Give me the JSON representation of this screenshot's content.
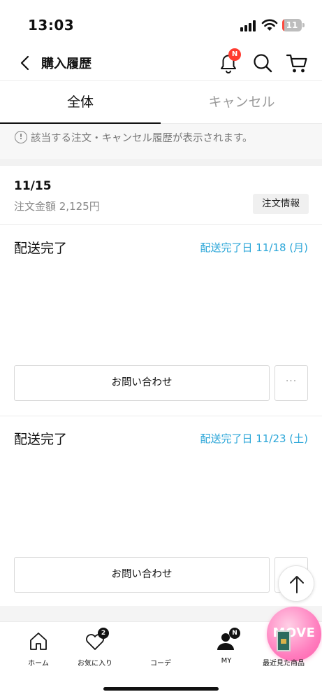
{
  "status_bar": {
    "time": "13:03",
    "battery": "11",
    "battery_level": 0.11
  },
  "header": {
    "title": "購入履歴",
    "bell_badge": "N"
  },
  "tabs": [
    {
      "label": "全体",
      "active": true
    },
    {
      "label": "キャンセル",
      "active": false
    }
  ],
  "notice": {
    "icon": "!",
    "text": "該当する注文・キャンセル履歴が表示されます。"
  },
  "order": {
    "date": "11/15",
    "amount": "注文金額 2,125円",
    "info_button": "注文情報",
    "deliveries": [
      {
        "status": "配送完了",
        "date": "配送完了日 11/18 (月)",
        "inquiry": "お問い合わせ",
        "more": "···"
      },
      {
        "status": "配送完了",
        "date": "配送完了日 11/23 (土)",
        "inquiry": "お問い合わせ",
        "more": "···"
      }
    ]
  },
  "tabbar": {
    "items": [
      {
        "label": "ホーム",
        "icon": "home-icon"
      },
      {
        "label": "お気に入り",
        "icon": "heart-icon",
        "badge": "2"
      },
      {
        "label": "コーデ",
        "icon": "move-logo",
        "logo_text": "MOVE"
      },
      {
        "label": "MY",
        "icon": "person-icon",
        "badge": "N"
      },
      {
        "label": "最近見た商品",
        "icon": "recent-item-thumbnail"
      }
    ]
  },
  "colors": {
    "accent_blue": "#2ba6d8",
    "badge_red": "#ff3b30",
    "move_pink": "#ff7fbf"
  }
}
